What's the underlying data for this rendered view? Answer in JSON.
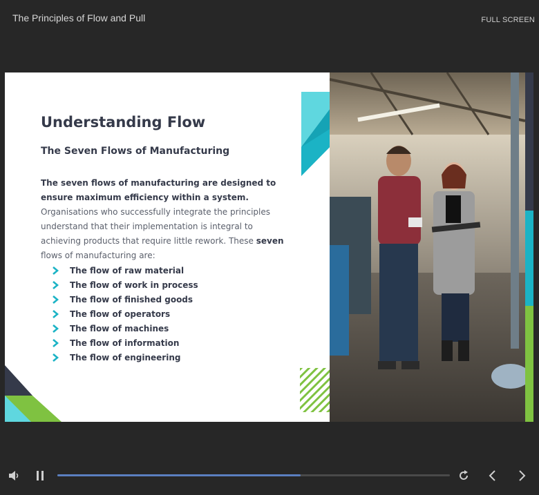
{
  "header": {
    "course_title": "The Principles of Flow and Pull",
    "fullscreen_label": "FULL SCREEN"
  },
  "slide": {
    "heading": "Understanding Flow",
    "subheading": "The Seven Flows of Manufacturing",
    "intro": {
      "bold_lead": "The seven flows of manufacturing are designed to ensure maximum efficiency within a system.",
      "text_1": " Organisations who successfully integrate the principles understand that their implementation is integral to achieving products that require little rework. These ",
      "bold_word": "seven",
      "text_2": " flows of manufacturing are:"
    },
    "flows": [
      "The flow of raw material",
      "The flow of work in process",
      "The flow of finished goods",
      "The flow of operators",
      "The flow of machines",
      "The flow of information",
      "The flow of engineering"
    ],
    "image_subject": "two workers reviewing a clipboard in a factory workshop"
  },
  "player": {
    "progress_fraction": 0.62,
    "icons": {
      "volume": "volume-icon",
      "pause": "pause-icon",
      "replay": "replay-icon",
      "prev": "chevron-left-icon",
      "next": "chevron-right-icon"
    }
  },
  "colors": {
    "teal": "#1bb3c5",
    "light_teal": "#5fd7df",
    "green": "#7fc241",
    "navy": "#353a4a",
    "progress": "#5b7fc0"
  }
}
